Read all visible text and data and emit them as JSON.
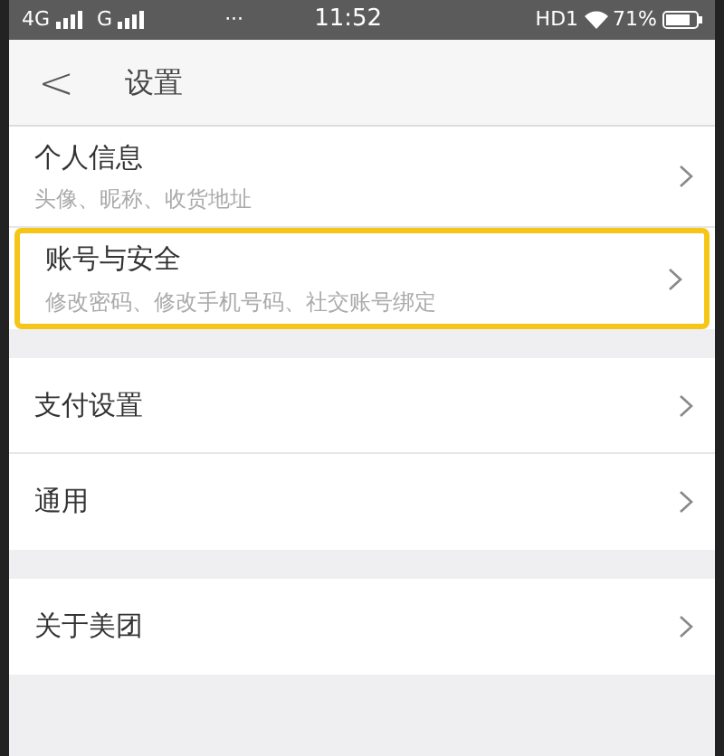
{
  "status_bar": {
    "network_1": "4G",
    "network_2": "G",
    "more": "···",
    "time": "11:52",
    "hd": "HD1",
    "battery": "71%"
  },
  "header": {
    "back": "<",
    "title": "设置"
  },
  "sections": [
    {
      "items": [
        {
          "title": "个人信息",
          "subtitle": "头像、昵称、收货地址",
          "highlighted": false
        },
        {
          "title": "账号与安全",
          "subtitle": "修改密码、修改手机号码、社交账号绑定",
          "highlighted": true
        }
      ]
    },
    {
      "items": [
        {
          "title": "支付设置",
          "highlighted": false
        },
        {
          "title": "通用",
          "highlighted": false
        }
      ]
    },
    {
      "items": [
        {
          "title": "关于美团",
          "highlighted": false
        }
      ]
    }
  ]
}
